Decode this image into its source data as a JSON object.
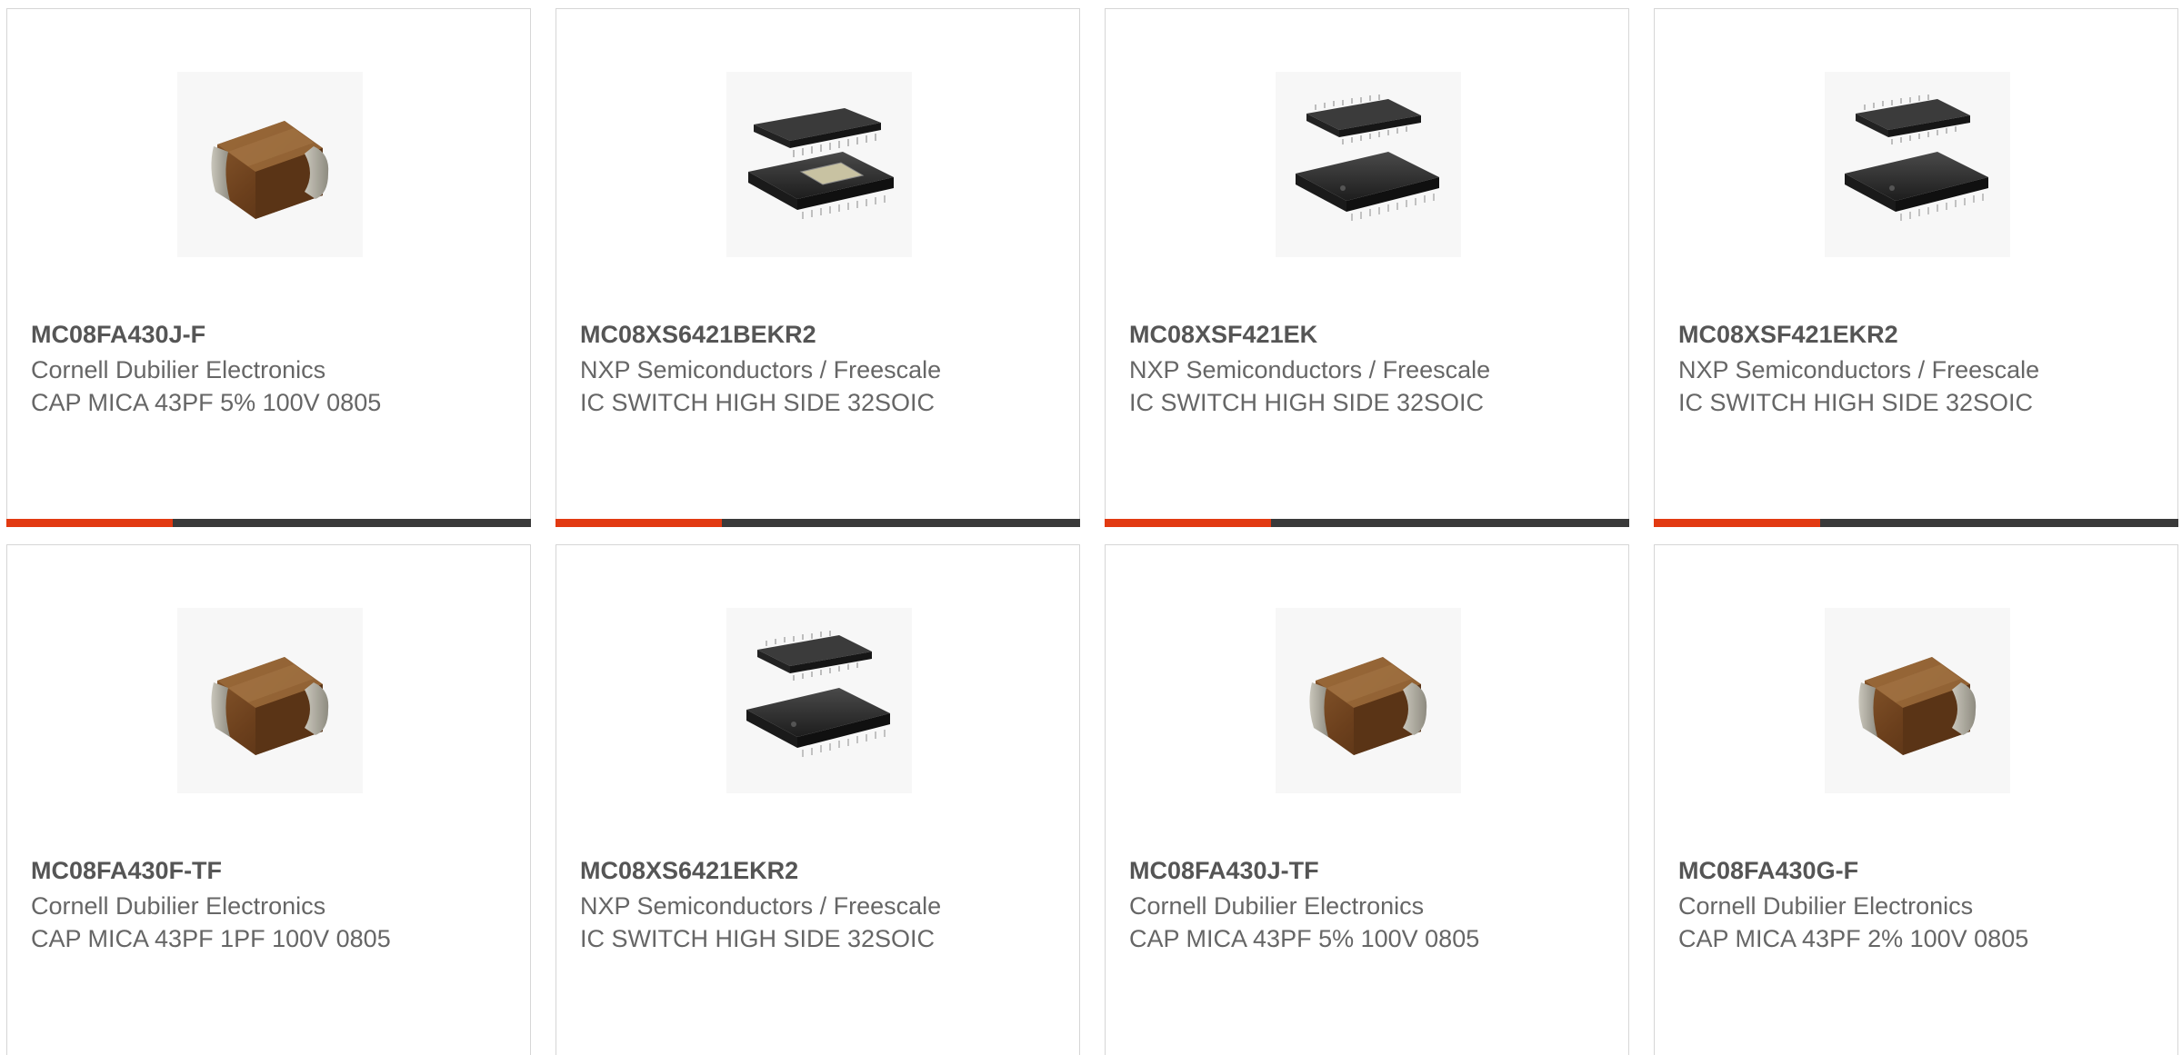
{
  "products": [
    {
      "part": "MC08FA430J-F",
      "manufacturer": "Cornell Dubilier Electronics",
      "description": "CAP MICA 43PF 5% 100V 0805",
      "image_icon": "mica-capacitor-icon"
    },
    {
      "part": "MC08XS6421BEKR2",
      "manufacturer": "NXP Semiconductors / Freescale",
      "description": "IC SWITCH HIGH SIDE 32SOIC",
      "image_icon": "soic-chip-icon"
    },
    {
      "part": "MC08XSF421EK",
      "manufacturer": "NXP Semiconductors / Freescale",
      "description": "IC SWITCH HIGH SIDE 32SOIC",
      "image_icon": "soic-chip-icon"
    },
    {
      "part": "MC08XSF421EKR2",
      "manufacturer": "NXP Semiconductors / Freescale",
      "description": "IC SWITCH HIGH SIDE 32SOIC",
      "image_icon": "soic-chip-icon"
    },
    {
      "part": "MC08FA430F-TF",
      "manufacturer": "Cornell Dubilier Electronics",
      "description": "CAP MICA 43PF 1PF 100V 0805",
      "image_icon": "mica-capacitor-icon"
    },
    {
      "part": "MC08XS6421EKR2",
      "manufacturer": "NXP Semiconductors / Freescale",
      "description": "IC SWITCH HIGH SIDE 32SOIC",
      "image_icon": "soic-chip-icon"
    },
    {
      "part": "MC08FA430J-TF",
      "manufacturer": "Cornell Dubilier Electronics",
      "description": "CAP MICA 43PF 5% 100V 0805",
      "image_icon": "mica-capacitor-icon"
    },
    {
      "part": "MC08FA430G-F",
      "manufacturer": "Cornell Dubilier Electronics",
      "description": "CAP MICA 43PF 2% 100V 0805",
      "image_icon": "mica-capacitor-icon"
    }
  ],
  "colors": {
    "accent": "#e23a12",
    "bar": "#3a3a3a",
    "title_text": "#555555",
    "body_text": "#666666",
    "border": "#d6d6d6"
  }
}
